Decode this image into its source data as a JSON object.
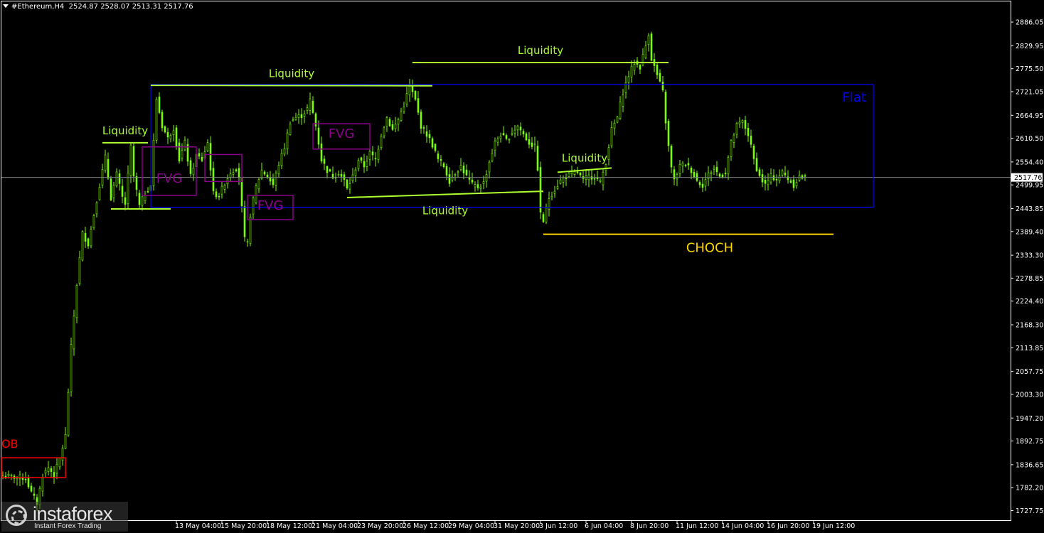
{
  "header": {
    "symbol_label": "#Ethereum,H4",
    "ohlc_label": "2524.87 2528.07 2513.31 2517.76"
  },
  "watermark": {
    "brand": "instaforex",
    "tagline": "Instant Forex Trading"
  },
  "colors": {
    "background": "#000000",
    "frame": "#ffffff",
    "candle": "#7cfc00",
    "liquidity": "#adff2f",
    "flat_box": "#0000ff",
    "fvg": "#8b008b",
    "ob": "#ff0000",
    "choch": "#ffd700",
    "bid_line": "#808080",
    "axis_text": "#ffffff"
  },
  "chart_data": {
    "type": "candlestick",
    "symbol": "#Ethereum",
    "timeframe": "H4",
    "last_price": 2517.76,
    "last_price_label": "2517.76",
    "ylim": [
      1705,
      2935
    ],
    "y_ticks": [
      1727.75,
      1782.2,
      1836.65,
      1892.75,
      1947.2,
      2003.3,
      2057.75,
      2113.85,
      2168.3,
      2224.4,
      2278.85,
      2333.3,
      2389.4,
      2443.85,
      2499.95,
      2554.4,
      2610.5,
      2664.95,
      2721.05,
      2775.5,
      2829.95,
      2886.05
    ],
    "y_tick_labels": [
      "1727.75",
      "1782.20",
      "1836.65",
      "1892.75",
      "1947.20",
      "2003.30",
      "2057.75",
      "2113.85",
      "2168.30",
      "2224.40",
      "2278.85",
      "2333.30",
      "2389.40",
      "2443.85",
      "2499.95",
      "2554.40",
      "2610.50",
      "2664.95",
      "2721.05",
      "2775.50",
      "2829.95",
      "2886.05"
    ],
    "x_ticks": [
      "13 May 04:00",
      "15 May 20:00",
      "18 May 12:00",
      "21 May 04:00",
      "23 May 20:00",
      "26 May 12:00",
      "29 May 04:00",
      "31 May 20:00",
      "3 Jun 12:00",
      "6 Jun 04:00",
      "8 Jun 20:00",
      "11 Jun 12:00",
      "14 Jun 04:00",
      "16 Jun 20:00",
      "19 Jun 12:00"
    ],
    "x_tick_bars": [
      61,
      77,
      93,
      109,
      125,
      141,
      157,
      173,
      189,
      205,
      221,
      237,
      253,
      269,
      285
    ],
    "bar_count": 295,
    "path": [
      [
        0,
        1810
      ],
      [
        8,
        1805
      ],
      [
        10,
        1770
      ],
      [
        12,
        1745
      ],
      [
        14,
        1812
      ],
      [
        16,
        1830
      ],
      [
        18,
        1812
      ],
      [
        20,
        1850
      ],
      [
        22,
        1905
      ],
      [
        24,
        2115
      ],
      [
        26,
        2265
      ],
      [
        28,
        2385
      ],
      [
        30,
        2360
      ],
      [
        32,
        2430
      ],
      [
        34,
        2500
      ],
      [
        36,
        2565
      ],
      [
        38,
        2470
      ],
      [
        40,
        2525
      ],
      [
        42,
        2470
      ],
      [
        43,
        2455
      ],
      [
        45,
        2590
      ],
      [
        46,
        2520
      ],
      [
        48,
        2450
      ],
      [
        50,
        2480
      ],
      [
        52,
        2500
      ],
      [
        54,
        2705
      ],
      [
        56,
        2640
      ],
      [
        58,
        2610
      ],
      [
        60,
        2635
      ],
      [
        62,
        2560
      ],
      [
        64,
        2600
      ],
      [
        66,
        2520
      ],
      [
        68,
        2570
      ],
      [
        70,
        2560
      ],
      [
        72,
        2600
      ],
      [
        74,
        2480
      ],
      [
        76,
        2475
      ],
      [
        78,
        2505
      ],
      [
        80,
        2530
      ],
      [
        82,
        2540
      ],
      [
        83,
        2520
      ],
      [
        84,
        2445
      ],
      [
        85,
        2370
      ],
      [
        86,
        2360
      ],
      [
        87,
        2430
      ],
      [
        89,
        2495
      ],
      [
        91,
        2535
      ],
      [
        93,
        2520
      ],
      [
        95,
        2500
      ],
      [
        97,
        2550
      ],
      [
        99,
        2590
      ],
      [
        101,
        2650
      ],
      [
        103,
        2660
      ],
      [
        105,
        2665
      ],
      [
        107,
        2680
      ],
      [
        108,
        2700
      ],
      [
        110,
        2640
      ],
      [
        112,
        2560
      ],
      [
        114,
        2535
      ],
      [
        116,
        2520
      ],
      [
        118,
        2530
      ],
      [
        120,
        2510
      ],
      [
        121,
        2490
      ],
      [
        123,
        2520
      ],
      [
        125,
        2560
      ],
      [
        127,
        2545
      ],
      [
        129,
        2575
      ],
      [
        131,
        2560
      ],
      [
        133,
        2620
      ],
      [
        135,
        2660
      ],
      [
        137,
        2630
      ],
      [
        139,
        2655
      ],
      [
        141,
        2690
      ],
      [
        143,
        2735
      ],
      [
        145,
        2700
      ],
      [
        147,
        2640
      ],
      [
        149,
        2620
      ],
      [
        151,
        2595
      ],
      [
        153,
        2560
      ],
      [
        155,
        2545
      ],
      [
        157,
        2510
      ],
      [
        159,
        2530
      ],
      [
        161,
        2545
      ],
      [
        163,
        2520
      ],
      [
        165,
        2500
      ],
      [
        167,
        2495
      ],
      [
        169,
        2505
      ],
      [
        171,
        2555
      ],
      [
        173,
        2600
      ],
      [
        175,
        2620
      ],
      [
        177,
        2605
      ],
      [
        179,
        2625
      ],
      [
        181,
        2640
      ],
      [
        183,
        2620
      ],
      [
        185,
        2600
      ],
      [
        187,
        2590
      ],
      [
        188,
        2540
      ],
      [
        189,
        2430
      ],
      [
        190,
        2415
      ],
      [
        192,
        2470
      ],
      [
        194,
        2490
      ],
      [
        196,
        2510
      ],
      [
        198,
        2520
      ],
      [
        200,
        2525
      ],
      [
        202,
        2530
      ],
      [
        204,
        2510
      ],
      [
        206,
        2520
      ],
      [
        208,
        2520
      ],
      [
        210,
        2505
      ],
      [
        212,
        2555
      ],
      [
        214,
        2630
      ],
      [
        216,
        2660
      ],
      [
        218,
        2720
      ],
      [
        220,
        2760
      ],
      [
        222,
        2790
      ],
      [
        224,
        2780
      ],
      [
        226,
        2830
      ],
      [
        227,
        2860
      ],
      [
        228,
        2800
      ],
      [
        230,
        2760
      ],
      [
        232,
        2720
      ],
      [
        233,
        2650
      ],
      [
        234,
        2590
      ],
      [
        235,
        2540
      ],
      [
        236,
        2510
      ],
      [
        238,
        2545
      ],
      [
        240,
        2550
      ],
      [
        242,
        2535
      ],
      [
        244,
        2510
      ],
      [
        246,
        2500
      ],
      [
        248,
        2525
      ],
      [
        250,
        2540
      ],
      [
        252,
        2520
      ],
      [
        254,
        2530
      ],
      [
        256,
        2600
      ],
      [
        258,
        2640
      ],
      [
        260,
        2650
      ],
      [
        262,
        2620
      ],
      [
        264,
        2560
      ],
      [
        266,
        2520
      ],
      [
        268,
        2500
      ],
      [
        270,
        2520
      ],
      [
        272,
        2515
      ],
      [
        274,
        2530
      ],
      [
        276,
        2515
      ],
      [
        278,
        2500
      ],
      [
        280,
        2520
      ],
      [
        282,
        2515
      ]
    ],
    "annotations": {
      "flat_box": {
        "label": "Flat",
        "bar_start": 52,
        "bar_end": 306,
        "price_top": 2738,
        "price_bottom": 2447
      },
      "choch": {
        "label": "CHOCH",
        "bar_start": 190,
        "bar_end": 292,
        "price": 2383
      },
      "ob": {
        "label": "OB",
        "bar_start": 0,
        "bar_end": 22,
        "price_top": 1853,
        "price_bottom": 1806
      },
      "fvg_boxes": [
        {
          "label": "FVG",
          "bar_start": 49,
          "bar_end": 68,
          "price_top": 2590,
          "price_bottom": 2475
        },
        {
          "label": "",
          "bar_start": 71,
          "bar_end": 84,
          "price_top": 2572,
          "price_bottom": 2508
        },
        {
          "label": "FVG",
          "bar_start": 109,
          "bar_end": 129,
          "price_top": 2645,
          "price_bottom": 2585
        },
        {
          "label": "FVG",
          "bar_start": 86,
          "bar_end": 102,
          "price_top": 2475,
          "price_bottom": 2418
        }
      ],
      "liquidity_lines": [
        {
          "label": "Liquidity",
          "bar_start": 35,
          "bar_end": 51,
          "price_start": 2600,
          "price_end": 2600,
          "label_pos": "above"
        },
        {
          "label": "",
          "bar_start": 38,
          "bar_end": 59,
          "price_start": 2443,
          "price_end": 2443,
          "label_pos": "none"
        },
        {
          "label": "Liquidity",
          "bar_start": 52,
          "bar_end": 151,
          "price_start": 2736,
          "price_end": 2735,
          "label_pos": "above"
        },
        {
          "label": "Liquidity",
          "bar_start": 144,
          "bar_end": 234,
          "price_start": 2790,
          "price_end": 2790,
          "label_pos": "above"
        },
        {
          "label": "Liquidity",
          "bar_start": 121,
          "bar_end": 190,
          "price_start": 2470,
          "price_end": 2485,
          "label_pos": "below"
        },
        {
          "label": "Liquidity",
          "bar_start": 195,
          "bar_end": 214,
          "price_start": 2530,
          "price_end": 2540,
          "label_pos": "above"
        }
      ]
    }
  }
}
